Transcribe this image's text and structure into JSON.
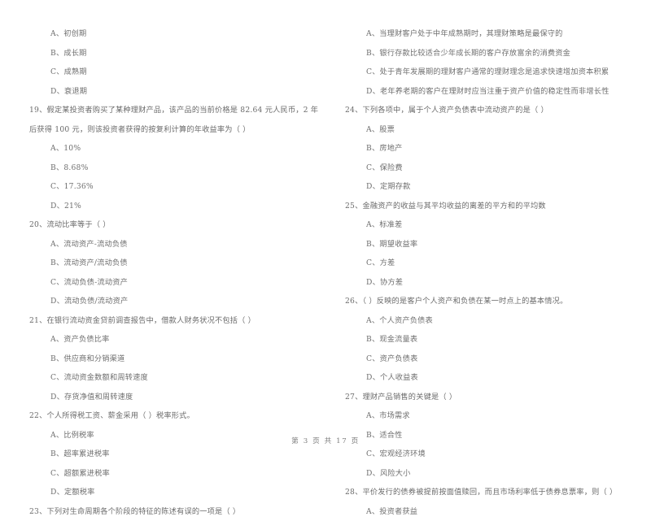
{
  "document": {
    "type": "exam-paper",
    "language": "zh-CN",
    "footer": "第 3 页 共 17 页"
  },
  "left_column": [
    {
      "id": "q18-options-continued",
      "stem": "",
      "options": [
        "A、初创期",
        "B、成长期",
        "C、成熟期",
        "D、衰退期"
      ]
    },
    {
      "id": "q19",
      "stem": "19、假定某投资者购买了某种理财产品，该产品的当前价格是 82.64 元人民币，2 年后获得 100 元，则该投资者获得的按复利计算的年收益率为（      ）",
      "options": [
        "A、10%",
        "B、8.68%",
        "C、17.36%",
        "D、21%"
      ]
    },
    {
      "id": "q20",
      "stem": "20、流动比率等于（      ）",
      "options": [
        "A、流动资产-流动负债",
        "B、流动资产/流动负债",
        "C、流动负债-流动资产",
        "D、流动负债/流动资产"
      ]
    },
    {
      "id": "q21",
      "stem": "21、在银行流动资金贷前调查报告中，借款人财务状况不包括（      ）",
      "options": [
        "A、资产负债比率",
        "B、供应商和分销渠道",
        "C、流动资金数额和周转速度",
        "D、存货净值和周转速度"
      ]
    },
    {
      "id": "q22",
      "stem": "22、个人所得税工资、薪金采用（      ）税率形式。",
      "options": [
        "A、比例税率",
        "B、超率累进税率",
        "C、超额累进税率",
        "D、定额税率"
      ]
    },
    {
      "id": "q23",
      "stem": "23、下列对生命周期各个阶段的特征的陈述有误的一项是（      ）",
      "options": []
    }
  ],
  "right_column": [
    {
      "id": "q23-options-continued",
      "stem": "",
      "options": [
        "A、当理财客户处于中年成熟期时，其理财策略是最保守的",
        "B、银行存款比较适合少年成长期的客户存放富余的消费资金",
        "C、处于青年发展期的理财客户通常的理财理念是追求快速增加资本积累",
        "D、老年养老期的客户在理财时应当注重于资产价值的稳定性而非增长性"
      ]
    },
    {
      "id": "q24",
      "stem": "24、下列各项中，属于个人资产负债表中流动资产的是（      ）",
      "options": [
        "A、股票",
        "B、房地产",
        "C、保险费",
        "D、定期存款"
      ]
    },
    {
      "id": "q25",
      "stem": "25、金融资产的收益与其平均收益的离差的平方和的平均数",
      "options": [
        "A、标准差",
        "B、期望收益率",
        "C、方差",
        "D、协方差"
      ]
    },
    {
      "id": "q26",
      "stem": "26、（      ）反映的是客户个人资产和负债在某一时点上的基本情况。",
      "options": [
        "A、个人资产负债表",
        "B、现金流量表",
        "C、资产负债表",
        "D、个人收益表"
      ]
    },
    {
      "id": "q27",
      "stem": "27、理财产品销售的关键是（      ）",
      "options": [
        "A、市场需求",
        "B、适合性",
        "C、宏观经济环境",
        "D、风险大小"
      ]
    },
    {
      "id": "q28",
      "stem": "28、平价发行的债券被提前按面值赎回，而且市场利率低于债券息票率，则（      ）",
      "options": [
        "A、投资者获益"
      ]
    }
  ]
}
